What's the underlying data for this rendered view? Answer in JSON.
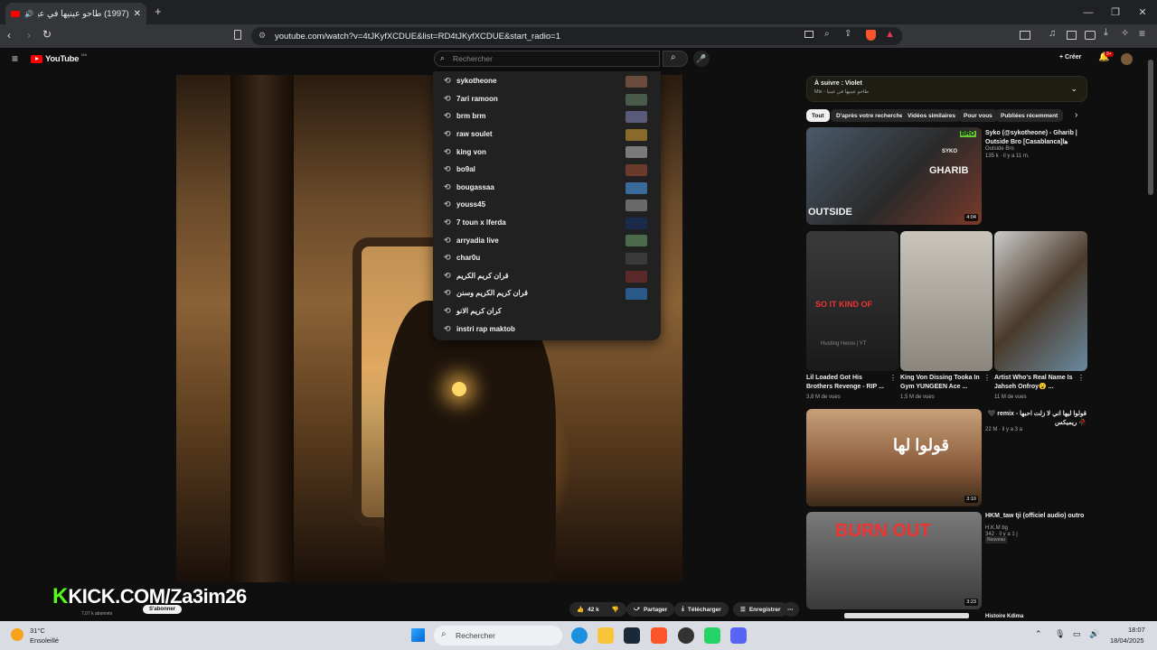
{
  "browser": {
    "tab_title": "(1997) طاحو عينيها في عينيا",
    "url": "youtube.com/watch?v=4tJKyfXCDUE&list=RD4tJKyfXCDUE&start_radio=1"
  },
  "youtube": {
    "logo": "YouTube",
    "logo_sup": "MA",
    "search_placeholder": "Rechercher",
    "create_label": "Créer",
    "notif_count": "9+"
  },
  "suggestions": [
    "sykotheone",
    "7ari ramoon",
    "brm brm",
    "raw soulet",
    "king von",
    "bo9al",
    "bougassaa",
    "youss45",
    "7 toun x lferda",
    "arryadia live",
    "char0u",
    "قران كريم الكريم",
    "قران كريم الكريم وسنن",
    "كران كريم الانو",
    "instri rap maktob"
  ],
  "sidebar": {
    "up_next_label": "À suivre : Violet",
    "up_next_sub": "Mix - طاحو عينيها في عينيا",
    "chips": [
      "Tout",
      "D'après votre recherche",
      "Vidéos similaires",
      "Pour vous",
      "Publiées récemment"
    ],
    "videos": [
      {
        "title": "Syko (@sykotheone) - Gharib | Outside Bro [Casablanca]ها",
        "channel": "Outside Bro",
        "meta": "135 k · il y a 11 m.",
        "duration": "4:04"
      },
      {
        "title": "Lil Loaded Got His Brothers Revenge - RIP ...",
        "meta": "3,8 M de vues"
      },
      {
        "title": "King Von Dissing Tooka In Gym YUNGEEN Ace ...",
        "meta": "1,5 M de vues"
      },
      {
        "title": "Artist Who's Real Name Is Jahseh Onfroy😮 ...",
        "meta": "11 M de vues"
      },
      {
        "title": "قولوا ليها اني لا زلت احبها - remix 🖤🥀 ريميكس",
        "meta": "22 M · il y a 3 a",
        "duration": "3:10"
      },
      {
        "title": "HKM_taw tji (officiel audio) outro",
        "channel": "H.K.M bg",
        "meta": "342 · il y a 1 j",
        "badge": "Nouveau",
        "duration": "3:23"
      },
      {
        "title": "Histoire Kdima"
      }
    ],
    "thumb_texts": {
      "syko": "SYKO",
      "gharib": "GHARIB",
      "outside": "OUTSIDE",
      "bro": "BRO",
      "so_it": "SO IT KIND OF",
      "watermark": "Husting Heros | YT",
      "burn": "BURN OUT",
      "arabic": "قولوا لها"
    }
  },
  "player": {
    "overlay": "KICK.COM/Za3im26",
    "subs": "7,07 k abonnés",
    "subscribe": "S'abonner",
    "likes": "42 k",
    "share": "Partager",
    "download": "Télécharger",
    "save": "Enregistrer"
  },
  "taskbar": {
    "temp": "31°C",
    "weather": "Ensoleillé",
    "search": "Rechercher",
    "time": "18:07",
    "date": "18/04/2025"
  },
  "colors": {
    "accent": "#ff0000",
    "kick": "#53fc18"
  }
}
